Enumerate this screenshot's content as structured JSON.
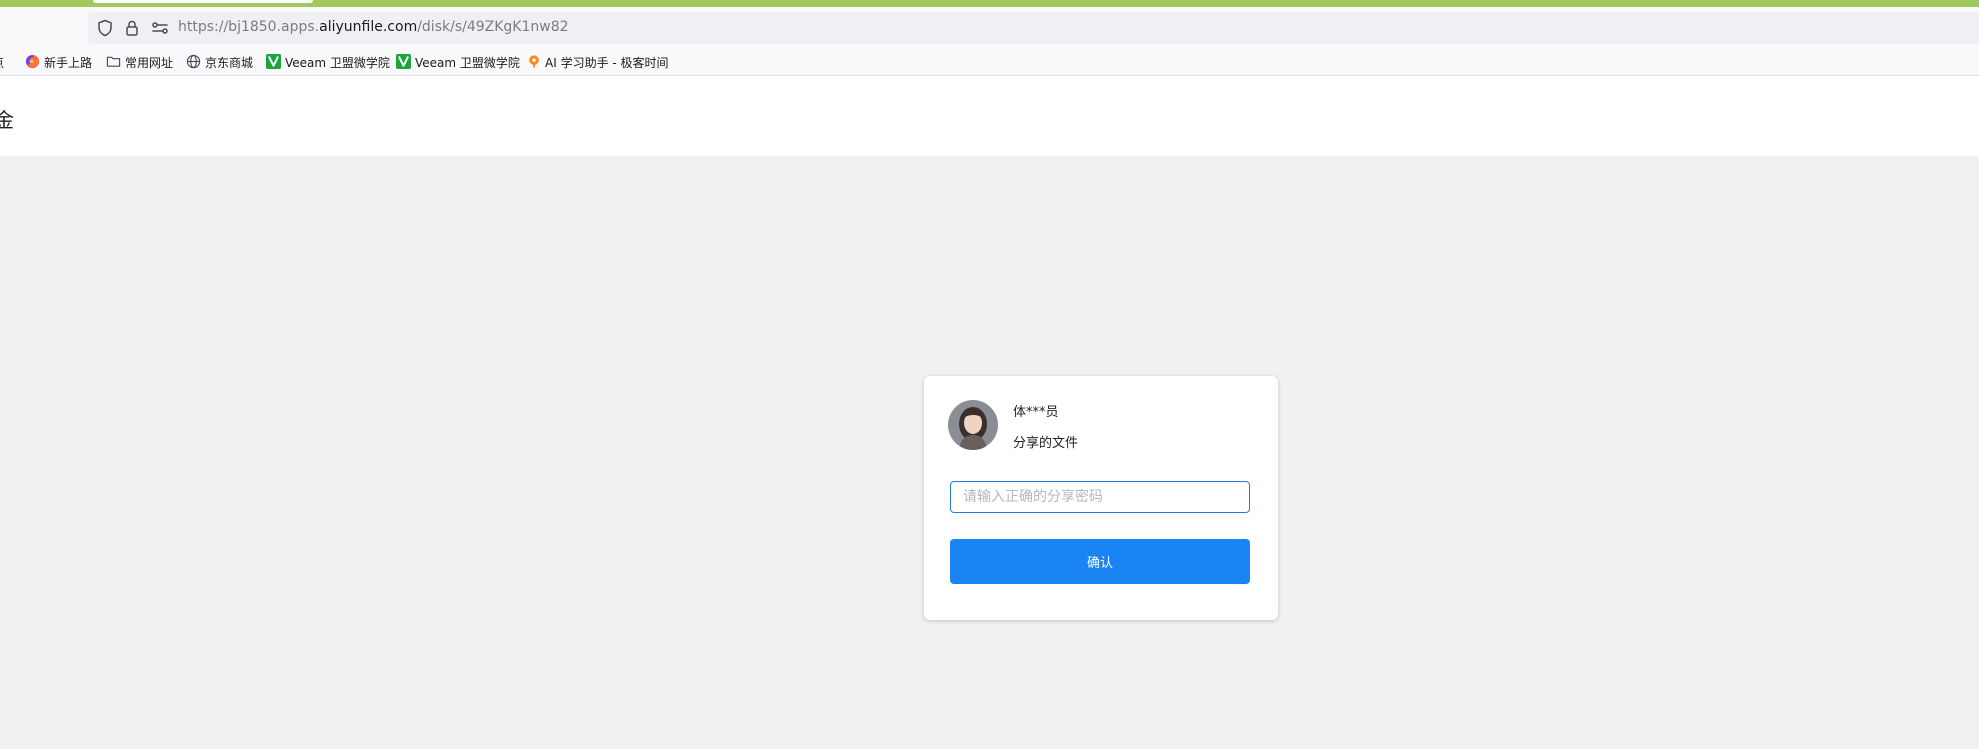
{
  "browser": {
    "url": {
      "prefix": "https://bj1850.apps.",
      "domain": "aliyunfile.com",
      "path": "/disk/s/49ZKgK1nw82"
    },
    "icons": [
      "shield-icon",
      "lock-icon",
      "permissions-icon"
    ]
  },
  "bookmarks": [
    {
      "label": "点",
      "icon": "none"
    },
    {
      "label": "新手上路",
      "icon": "firefox-icon"
    },
    {
      "label": "常用网址",
      "icon": "folder-icon"
    },
    {
      "label": "京东商城",
      "icon": "globe-icon"
    },
    {
      "label": "Veeam 卫盟微学院",
      "icon": "veeam-icon"
    },
    {
      "label": "Veeam 卫盟微学院",
      "icon": "veeam-icon"
    },
    {
      "label": "AI 学习助手 - 极客时间",
      "icon": "geektime-icon"
    }
  ],
  "header": {
    "text": "金"
  },
  "card": {
    "sharer_name": "体***员",
    "share_desc": "分享的文件",
    "password_placeholder": "请输入正确的分享密码",
    "password_value": "",
    "confirm_label": "确认"
  },
  "colors": {
    "accent_bar": "#9fc95a",
    "primary_button": "#1a84f5",
    "input_focus_border": "#2679e0",
    "page_background": "#f1f1f3",
    "veeam_green": "#1aa53b"
  }
}
